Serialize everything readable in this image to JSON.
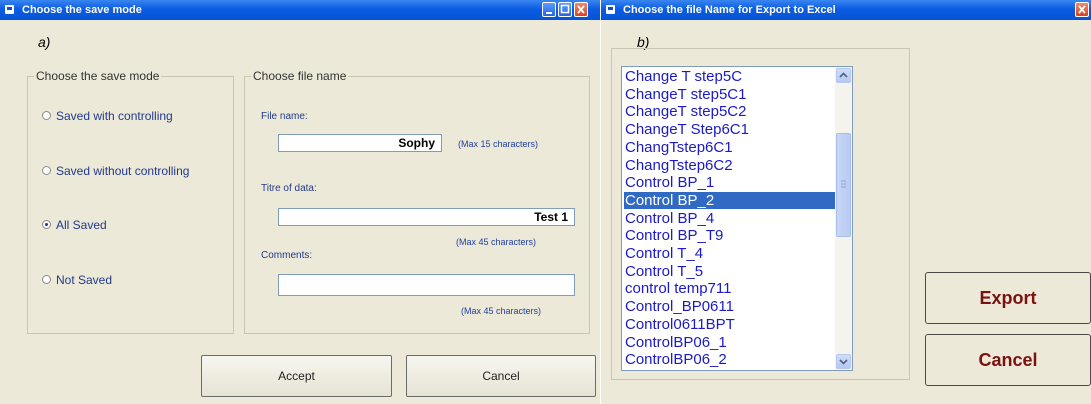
{
  "window_a": {
    "title": "Choose the save mode",
    "caption": "a)",
    "save_mode_group": {
      "label": "Choose the save mode",
      "options": [
        {
          "label": "Saved with controlling",
          "selected": false
        },
        {
          "label": "Saved without controlling",
          "selected": false
        },
        {
          "label": "All Saved",
          "selected": true
        },
        {
          "label": "Not Saved",
          "selected": false
        }
      ]
    },
    "file_group": {
      "label": "Choose file name",
      "file_name_label": "File name:",
      "file_name_value": "Sophy",
      "file_name_note": "(Max 15 characters)",
      "titre_label": "Titre of data:",
      "titre_value": "Test 1",
      "titre_note": "(Max 45 characters)",
      "comments_label": "Comments:",
      "comments_value": "",
      "comments_note": "(Max 45 characters)"
    },
    "accept_label": "Accept",
    "cancel_label": "Cancel"
  },
  "window_b": {
    "title": "Choose the file Name for Export to Excel",
    "caption": "b)",
    "list_items": [
      "Change T step5C",
      "ChangeT step5C1",
      "ChangeT step5C2",
      "ChangeT Step6C1",
      "ChangTstep6C1",
      "ChangTstep6C2",
      "Control BP_1",
      "Control BP_2",
      "Control BP_4",
      "Control BP_T9",
      "Control T_4",
      "Control T_5",
      "control temp711",
      "Control_BP0611",
      "Control0611BPT",
      "ControlBP06_1",
      "ControlBP06_2"
    ],
    "selected_index": 7,
    "export_label": "Export",
    "cancel_label": "Cancel"
  },
  "colors": {
    "title_bar": "#0654d4",
    "window_bg": "#ECE9D8",
    "list_text": "#1a1ac8",
    "selection": "#316AC5",
    "big_button_text": "#7b1111"
  }
}
